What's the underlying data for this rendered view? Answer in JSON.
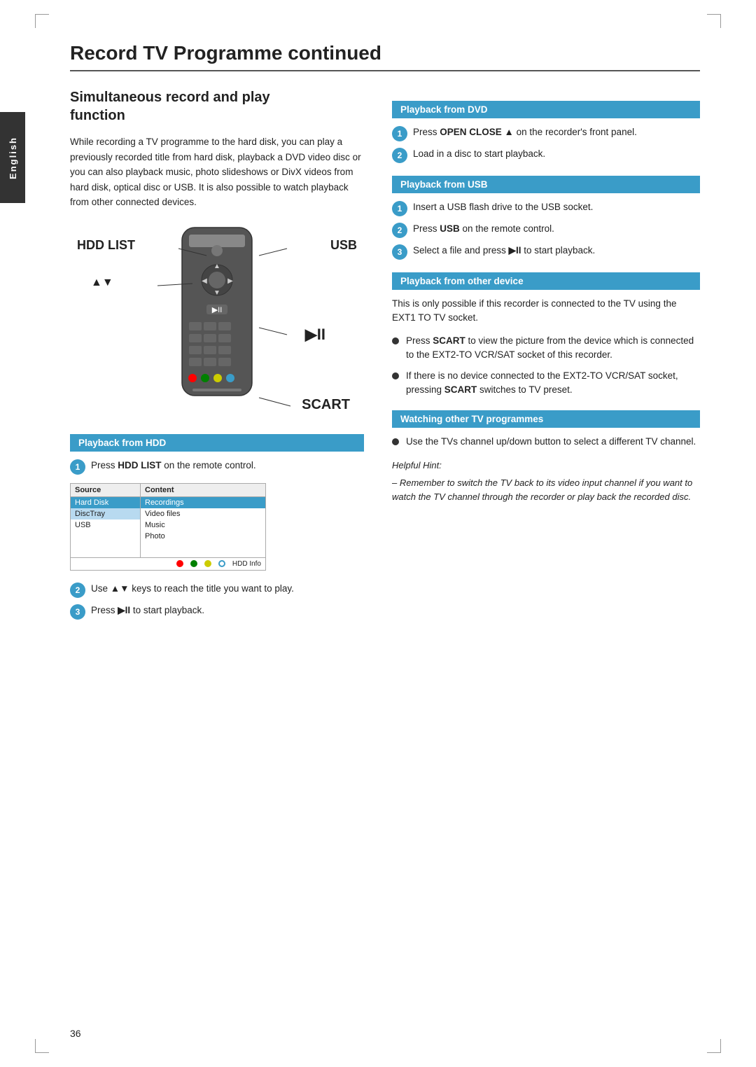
{
  "page": {
    "title": "Record TV Programme",
    "title_suffix": " continued",
    "page_number": "36",
    "side_tab": "English"
  },
  "left_col": {
    "section_title_line1": "Simultaneous record and play",
    "section_title_line2": "function",
    "intro_text": "While recording a TV programme to the hard disk, you can play a previously recorded title from hard disk, playback a DVD video disc or you can also playback music, photo slideshows or DivX videos from hard disk, optical disc or USB.  It is also possible to watch playback from other connected devices.",
    "remote_labels": {
      "hdd_list": "HDD LIST",
      "usb": "USB",
      "arrows": "▲▼",
      "play": "▶II",
      "scart": "SCART"
    },
    "playback_hdd": {
      "panel_label": "Playback from HDD",
      "step1": "Press HDD LIST on the remote control.",
      "step1_bold": "HDD LIST",
      "hdd_table": {
        "col_source": "Source",
        "col_content": "Content",
        "sources": [
          "Hard Disk",
          "DiscTray",
          "USB",
          "",
          "",
          "",
          ""
        ],
        "contents": [
          "Recordings",
          "Video files",
          "Music",
          "Photo",
          "",
          "",
          ""
        ],
        "footer_label": "HDD Info"
      },
      "step2": "Use ▲▼ keys to reach the title you want to play.",
      "step2_bold": "▲▼",
      "step3": "Press ▶II to start playback.",
      "step3_bold": "▶II"
    }
  },
  "right_col": {
    "playback_dvd": {
      "panel_label": "Playback from DVD",
      "step1": "Press OPEN CLOSE ▲ on the recorder's front panel.",
      "step1_bold": "OPEN CLOSE ▲",
      "step2": "Load in a disc to start playback."
    },
    "playback_usb": {
      "panel_label": "Playback from USB",
      "step1": "Insert a USB flash drive to the USB socket.",
      "step2": "Press USB on the remote control.",
      "step2_bold": "USB",
      "step3": "Select a file and press ▶II to start playback.",
      "step3_bold": "▶II"
    },
    "playback_other": {
      "panel_label": "Playback from other device",
      "intro": "This is only possible if this recorder is connected to the TV using the EXT1 TO TV socket.",
      "bullet1": "Press SCART to view the picture from the device which is connected to the EXT2-TO VCR/SAT socket of this recorder.",
      "bullet1_bold": "SCART",
      "bullet2": "If there is no device connected to the EXT2-TO VCR/SAT socket, pressing SCART switches to TV preset.",
      "bullet2_bold": "SCART"
    },
    "watching_other": {
      "panel_label": "Watching other TV programmes",
      "bullet1": "Use the TVs channel up/down button to select a different TV channel."
    },
    "helpful_hint": {
      "title": "Helpful Hint:",
      "text": "– Remember to switch the TV back to its video input channel if you want to watch the TV channel through the recorder or play back the recorded disc."
    }
  }
}
